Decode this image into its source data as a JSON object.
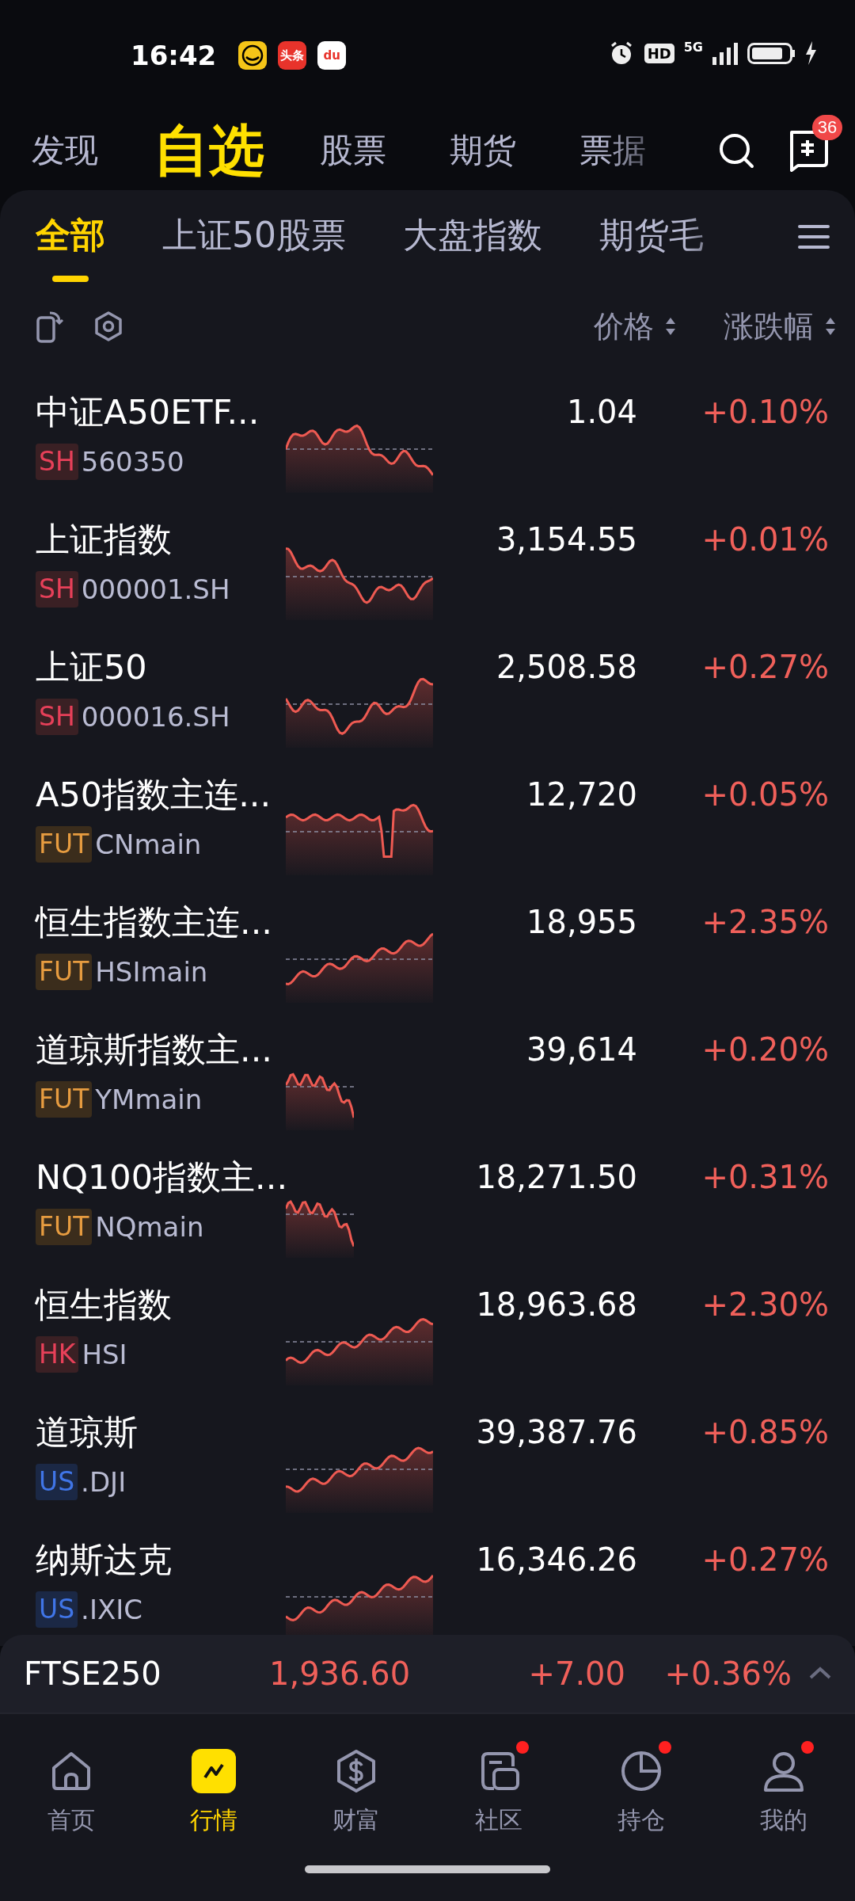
{
  "status_bar": {
    "time": "16:42",
    "app_icons": [
      {
        "kind": "logo"
      },
      {
        "kind": "text",
        "label": "头条"
      },
      {
        "kind": "text",
        "label": "du"
      }
    ],
    "hd": "HD",
    "network": "5G"
  },
  "top_nav": {
    "items": [
      {
        "label": "发现",
        "selected": false
      },
      {
        "label": "自选",
        "selected": true
      },
      {
        "label": "股票",
        "selected": false
      },
      {
        "label": "期货",
        "selected": false
      },
      {
        "label": "票据",
        "selected": false
      }
    ],
    "message_badge": "36"
  },
  "watchlist_tabs": [
    {
      "label": "全部",
      "selected": true
    },
    {
      "label": "上证50股票",
      "selected": false
    },
    {
      "label": "大盘指数",
      "selected": false
    },
    {
      "label": "期货毛",
      "selected": false
    }
  ],
  "columns": {
    "price": "价格",
    "change": "涨跌幅"
  },
  "rows": [
    {
      "name": "中证A50ETF...",
      "market": "SH",
      "color": "#3a2024",
      "code": "560350",
      "price": "1.04",
      "change": "+0.10%",
      "full_session": true
    },
    {
      "name": "上证指数",
      "market": "SH",
      "color": "#3a2024",
      "code": "000001.SH",
      "price": "3,154.55",
      "change": "+0.01%",
      "full_session": true
    },
    {
      "name": "上证50",
      "market": "SH",
      "color": "#3a2024",
      "code": "000016.SH",
      "price": "2,508.58",
      "change": "+0.27%",
      "full_session": true
    },
    {
      "name": "A50指数主连...",
      "market": "FUT",
      "color": "#3b2d1c",
      "code": "CNmain",
      "price": "12,720",
      "change": "+0.05%",
      "full_session": true
    },
    {
      "name": "恒生指数主连...",
      "market": "FUT",
      "color": "#3b2d1c",
      "code": "HSImain",
      "price": "18,955",
      "change": "+2.35%",
      "full_session": true
    },
    {
      "name": "道琼斯指数主...",
      "market": "FUT",
      "color": "#3b2d1c",
      "code": "YMmain",
      "price": "39,614",
      "change": "+0.20%",
      "full_session": false
    },
    {
      "name": "NQ100指数主...",
      "market": "FUT",
      "color": "#3b2d1c",
      "code": "NQmain",
      "price": "18,271.50",
      "change": "+0.31%",
      "full_session": false
    },
    {
      "name": "恒生指数",
      "market": "HK",
      "color": "#3a2024",
      "code": "HSI",
      "price": "18,963.68",
      "change": "+2.30%",
      "full_session": true
    },
    {
      "name": "道琼斯",
      "market": "US",
      "color": "#1b2845",
      "code": ".DJI",
      "price": "39,387.76",
      "change": "+0.85%",
      "full_session": true
    },
    {
      "name": "纳斯达克",
      "market": "US",
      "color": "#1b2845",
      "code": ".IXIC",
      "price": "16,346.26",
      "change": "+0.27%",
      "full_session": true
    }
  ],
  "ticker": {
    "name": "FTSE250",
    "price": "1,936.60",
    "change": "+7.00",
    "change_percent": "+0.36%"
  },
  "bottom_nav": [
    {
      "label": "首页",
      "selected": false,
      "dot": false
    },
    {
      "label": "行情",
      "selected": true,
      "dot": false
    },
    {
      "label": "财富",
      "selected": false,
      "dot": false
    },
    {
      "label": "社区",
      "selected": false,
      "dot": true
    },
    {
      "label": "持仓",
      "selected": false,
      "dot": true
    },
    {
      "label": "我的",
      "selected": false,
      "dot": true
    }
  ]
}
